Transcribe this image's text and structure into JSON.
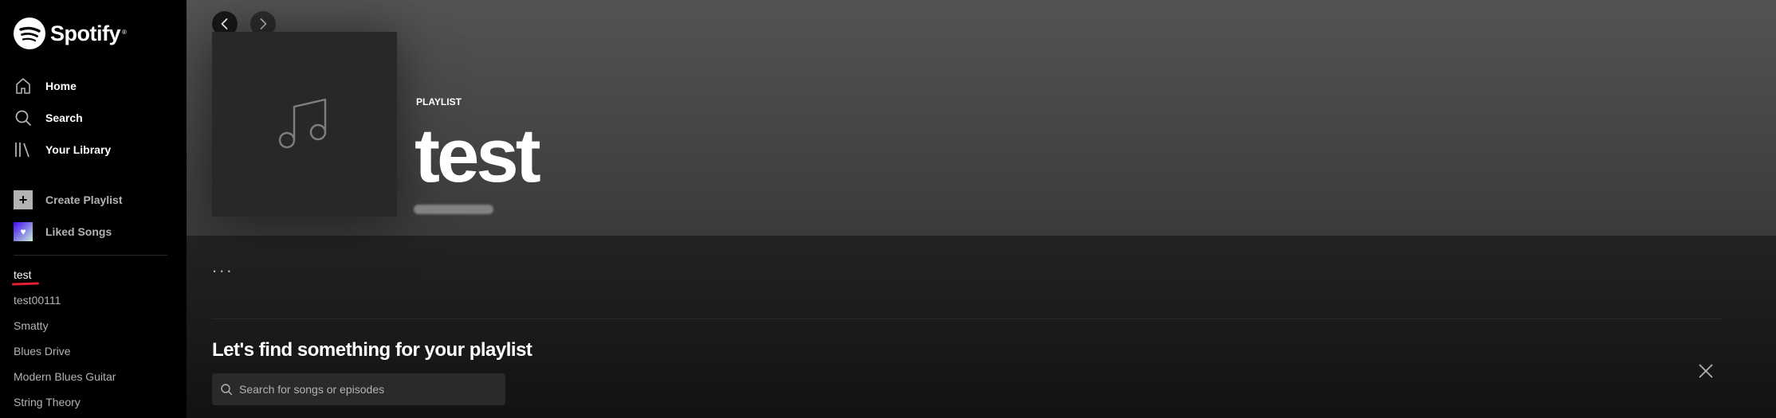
{
  "brand": {
    "name": "Spotify",
    "trademark": "®",
    "color": "#1db954"
  },
  "sidebar": {
    "nav": [
      {
        "label": "Home",
        "icon": "home-icon"
      },
      {
        "label": "Search",
        "icon": "search-icon"
      },
      {
        "label": "Your Library",
        "icon": "library-icon"
      }
    ],
    "actions": [
      {
        "label": "Create Playlist",
        "icon": "plus-icon"
      },
      {
        "label": "Liked Songs",
        "icon": "heart-icon"
      }
    ],
    "playlists": [
      "test",
      "test00111",
      "Smatty",
      "Blues Drive",
      "Modern Blues Guitar",
      "String Theory"
    ]
  },
  "hero": {
    "type": "PLAYLIST",
    "title": "test",
    "cover_icon": "music-note-icon"
  },
  "actions_bar": {
    "more_label": "..."
  },
  "finder": {
    "title": "Let's find something for your playlist",
    "search_placeholder": "Search for songs or episodes"
  },
  "colors": {
    "sidebar_bg": "#000000",
    "main_bg": "#121212",
    "hero_gradient_top": "#535353",
    "underline_accent": "#e22134"
  }
}
